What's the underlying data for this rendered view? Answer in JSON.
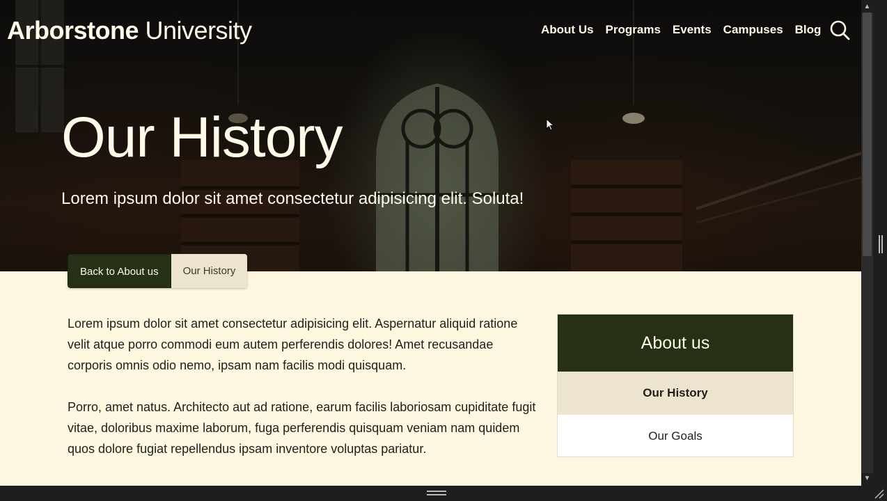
{
  "brand": {
    "bold": "Arborstone",
    "regular": "University"
  },
  "nav": {
    "items": [
      "About Us",
      "Programs",
      "Events",
      "Campuses",
      "Blog"
    ],
    "search_icon": "search-icon"
  },
  "hero": {
    "title": "Our History",
    "subtitle": "Lorem ipsum dolor sit amet consectetur adipisicing elit. Soluta!"
  },
  "breadcrumb": {
    "back_label": "Back to About us",
    "current_label": "Our History"
  },
  "content": {
    "paragraphs": [
      "Lorem ipsum dolor sit amet consectetur adipisicing elit. Aspernatur aliquid ratione velit atque porro commodi eum autem perferendis dolores! Amet recusandae corporis omnis odio nemo, ipsam nam facilis modi quisquam.",
      "Porro, amet natus. Architecto aut ad ratione, earum facilis laboriosam cupiditate fugit vitae, doloribus maxime laborum, fuga perferendis quisquam veniam nam quidem quos dolore fugiat repellendus ipsam inventore voluptas pariatur."
    ]
  },
  "sidebar": {
    "title": "About us",
    "items": [
      {
        "label": "Our History",
        "active": true
      },
      {
        "label": "Our Goals",
        "active": false
      }
    ]
  },
  "colors": {
    "primary_dark_green": "#263016",
    "cream_background": "#fff8e0",
    "tab_beige": "#ede4ce",
    "hero_text": "#fffbe8"
  }
}
